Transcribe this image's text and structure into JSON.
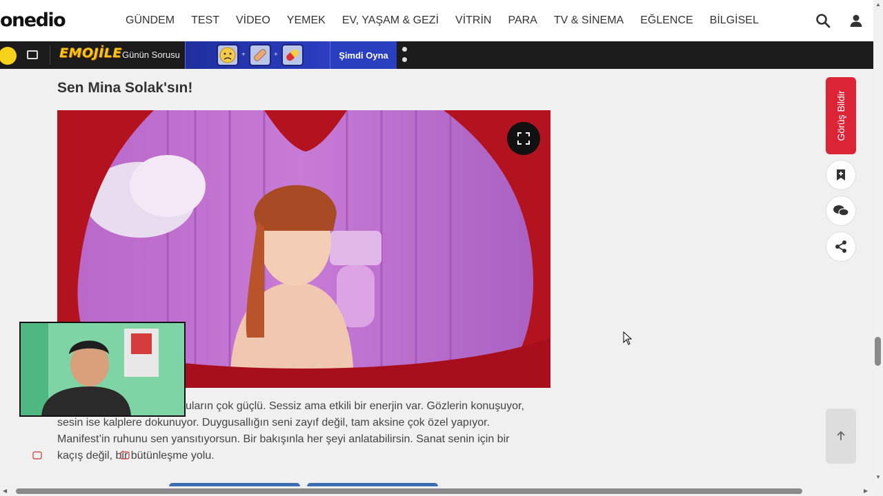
{
  "brand": {
    "logo_text": "onedio"
  },
  "nav": {
    "items": [
      "GÜNDEM",
      "TEST",
      "VİDEO",
      "YEMEK",
      "EV, YAŞAM & GEZİ",
      "VİTRİN",
      "PARA",
      "TV & SİNEMA",
      "EĞLENCE",
      "BİLGİSEL"
    ],
    "search_icon": "search-icon",
    "user_icon": "user-icon"
  },
  "emojile": {
    "logo": "EMOJİLE",
    "question_label": "Günün Sorusu",
    "tiles": [
      "worried-face-icon",
      "bandage-icon",
      "pill-icon"
    ],
    "play_label": "Şimdi Oyna"
  },
  "article": {
    "title": "Sen Mina Solak'sın!",
    "lines": [
      "Duyguların çok güçlü. Sessiz ama etkili bir enerjin var. Gözlerin konuşuyor,",
      "sesin ise kalplere dokunuyor. Duygusallığın seni zayıf değil, tam aksine çok özel yapıyor.",
      "Manifest’in ruhunu sen yansıtıyorsun. Bir bakışınla her şeyi anlatabilirsin. Sanat senin için bir",
      "kaçış değil, bir bütünleşme yolu."
    ],
    "visible_line1": "uların çok güçlü. Sessiz ama etkili bir enerjin var. Gözlerin konuşuyor,"
  },
  "sidebar": {
    "feedback_label": "Görüş Bildir"
  },
  "colors": {
    "accent_red": "#dc2437",
    "emojile_blue": "#2a3ec0",
    "emojile_yellow": "#f5c518"
  }
}
